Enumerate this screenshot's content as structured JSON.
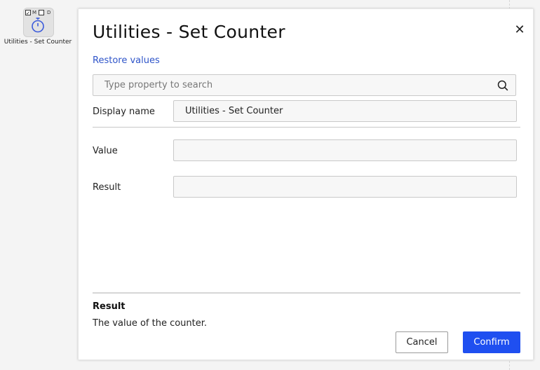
{
  "node": {
    "label": "Utilities - Set Counter",
    "flag_m": "M",
    "flag_d": "D",
    "check_mark": "✓"
  },
  "dialog": {
    "title": "Utilities - Set Counter",
    "close_glyph": "✕",
    "restore_link": "Restore values",
    "search_placeholder": "Type property to search",
    "fields": {
      "display_name_label": "Display name",
      "display_name_value": "Utilities - Set Counter",
      "value_label": "Value",
      "value_value": "",
      "result_label": "Result",
      "result_value": ""
    },
    "help": {
      "title": "Result",
      "text": "The value of the counter."
    },
    "buttons": {
      "cancel": "Cancel",
      "confirm": "Confirm"
    }
  },
  "colors": {
    "primary": "#1f4ff0",
    "link": "#2f55c9",
    "node_icon": "#3b5bdb"
  },
  "icons": [
    "stopwatch-icon",
    "search-icon",
    "close-icon",
    "checkbox-icon"
  ]
}
